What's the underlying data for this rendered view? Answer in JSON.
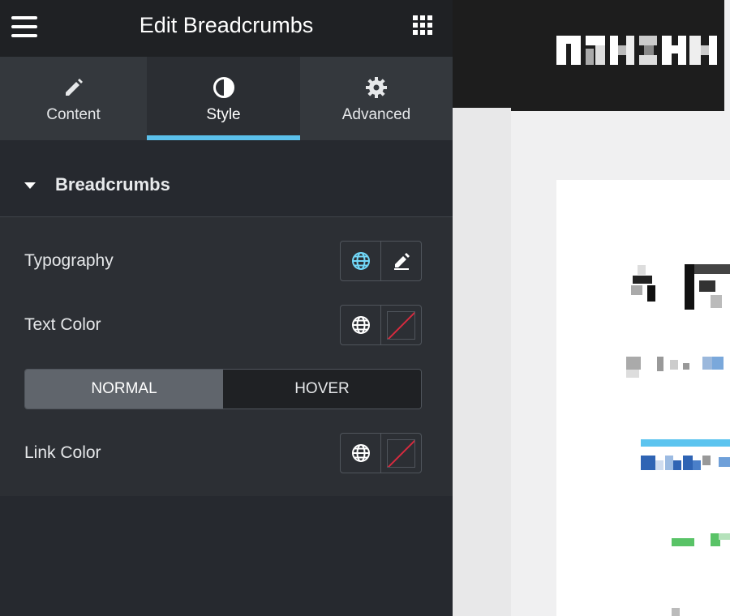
{
  "panel": {
    "title": "Edit Breadcrumbs",
    "menu_icon": "hamburger-menu-icon",
    "apps_icon": "grid-apps-icon"
  },
  "tabs": [
    {
      "label": "Content",
      "icon": "pencil-icon"
    },
    {
      "label": "Style",
      "icon": "half-circle-contrast-icon"
    },
    {
      "label": "Advanced",
      "icon": "gear-icon"
    }
  ],
  "active_tab": "Style",
  "section": {
    "title": "Breadcrumbs",
    "expanded": true
  },
  "controls": {
    "typography_label": "Typography",
    "text_color_label": "Text Color",
    "link_color_label": "Link Color",
    "state_toggle": {
      "options": [
        "NORMAL",
        "HOVER"
      ],
      "selected": "NORMAL"
    }
  },
  "colors": {
    "panel_bg": "#26292f",
    "topbar_bg": "#1f2124",
    "tabs_bg": "#34383d",
    "accent": "#5bc0eb",
    "globe_active": "#71d7f7",
    "no_color_line": "#d72b3f"
  }
}
